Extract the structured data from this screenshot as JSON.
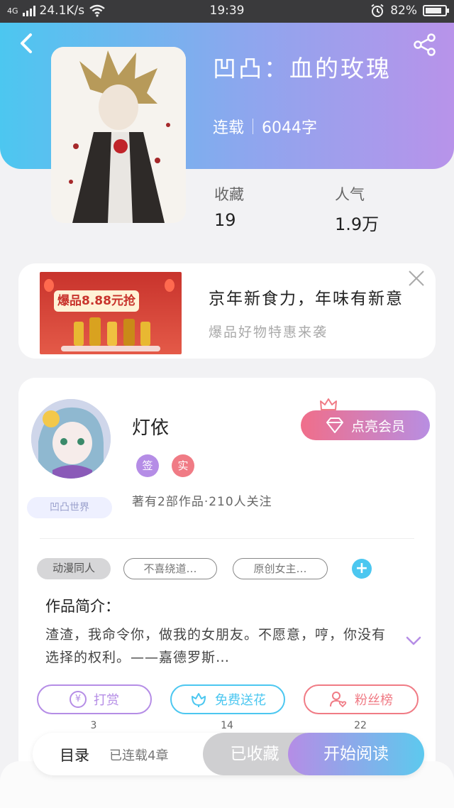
{
  "status_bar": {
    "network": "4G",
    "speed": "24.1K/s",
    "time": "19:39",
    "battery": "82%"
  },
  "book": {
    "title": "凹凸：血的玫瑰",
    "status": "连载",
    "word_count": "6044字",
    "stats": [
      {
        "label": "收藏",
        "value": "19"
      },
      {
        "label": "人气",
        "value": "1.9万"
      }
    ]
  },
  "ad": {
    "image_text": "爆品8.88元抢",
    "title": "京年新食力，年味有新意",
    "subtitle": "爆品好物特惠来袭"
  },
  "author": {
    "name": "灯依",
    "badges": [
      {
        "text": "签",
        "color": "#b58de6"
      },
      {
        "text": "实",
        "color": "#f07b85"
      }
    ],
    "world_badge": "凹凸世界",
    "vip_button": "点亮会员",
    "info": "著有2部作品·210人关注"
  },
  "tags": [
    "动漫同人",
    "不喜绕道…",
    "原创女主…"
  ],
  "intro": {
    "title": "作品简介：",
    "text": "渣渣，我命令你，做我的女朋友。不愿意，哼，你没有选择的权利。——嘉德罗斯…"
  },
  "actions": [
    {
      "label": "打赏",
      "count": "3",
      "color": "#b58de6",
      "icon": "yen-icon"
    },
    {
      "label": "免费送花",
      "count": "14",
      "color": "#4cc7f0",
      "icon": "flower-icon"
    },
    {
      "label": "粉丝榜",
      "count": "22",
      "color": "#f07b85",
      "icon": "user-heart-icon"
    }
  ],
  "bottom_bar": {
    "toc": "目录",
    "update_status": "已连载4章",
    "collected": "已收藏",
    "start_reading": "开始阅读"
  },
  "colors": {
    "header_gradient_start": "#4cc7f0",
    "header_gradient_end": "#b893ea",
    "accent_purple": "#b58de6",
    "accent_blue": "#4cc7f0",
    "accent_pink": "#f07b85"
  }
}
